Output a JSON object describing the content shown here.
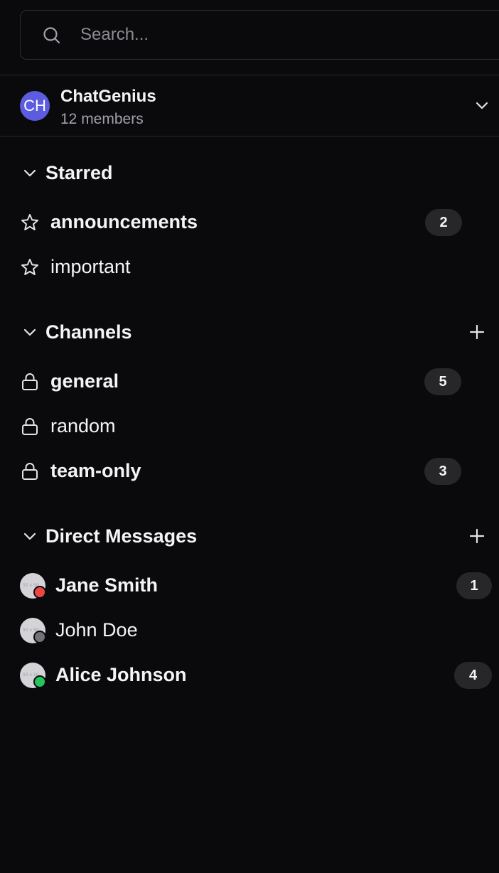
{
  "search": {
    "placeholder": "Search...",
    "icon": "search-icon"
  },
  "workspace": {
    "avatar_initials": "CH",
    "avatar_color": "#5b5ce0",
    "name": "ChatGenius",
    "members": "12 members"
  },
  "starred": {
    "title": "Starred",
    "items": [
      {
        "label": "announcements",
        "badge": "2",
        "unread": true,
        "icon": "star-icon"
      },
      {
        "label": "important",
        "badge": "",
        "unread": false,
        "icon": "star-icon"
      }
    ]
  },
  "channels": {
    "title": "Channels",
    "items": [
      {
        "label": "general",
        "badge": "5",
        "unread": true,
        "icon": "lock-icon"
      },
      {
        "label": "random",
        "badge": "",
        "unread": false,
        "icon": "lock-icon"
      },
      {
        "label": "team-only",
        "badge": "3",
        "unread": true,
        "icon": "lock-icon"
      }
    ]
  },
  "direct_messages": {
    "title": "Direct Messages",
    "items": [
      {
        "label": "Jane Smith",
        "badge": "1",
        "unread": true,
        "status_color": "#ef4444",
        "avatar_placeholder": "50 x 50"
      },
      {
        "label": "John Doe",
        "badge": "",
        "unread": false,
        "status_color": "#71717a",
        "avatar_placeholder": "50 x 50"
      },
      {
        "label": "Alice Johnson",
        "badge": "4",
        "unread": true,
        "status_color": "#22c55e",
        "avatar_placeholder": "50 x 50"
      }
    ]
  }
}
